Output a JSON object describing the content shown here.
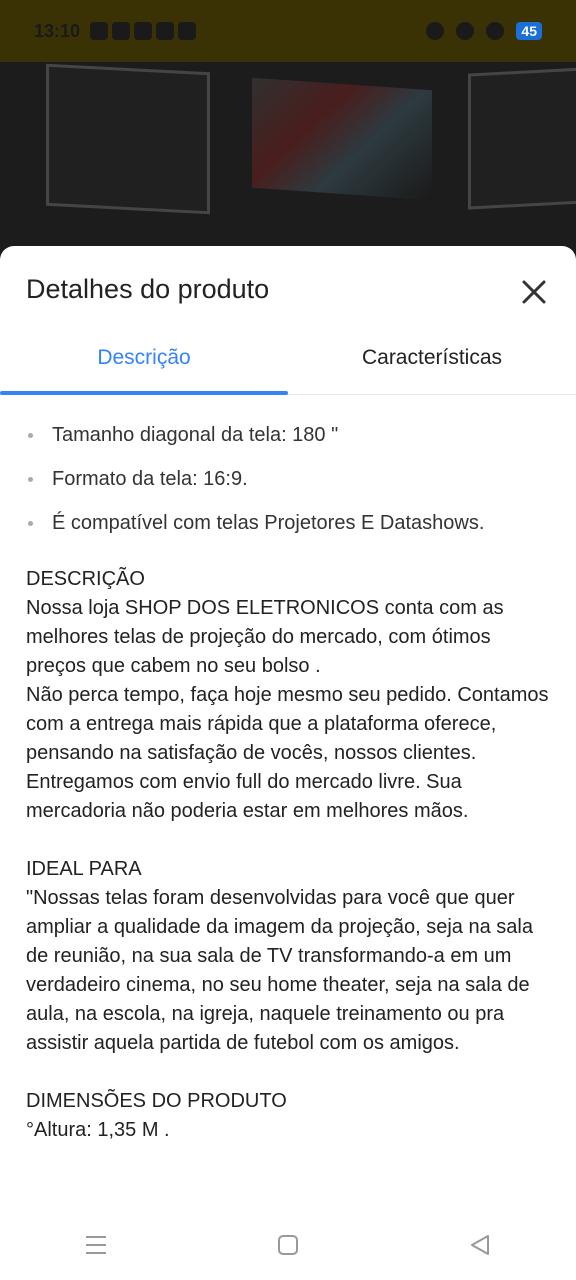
{
  "status_bar": {
    "time": "13:10",
    "battery": "45"
  },
  "sheet": {
    "title": "Detalhes do produto",
    "tabs": [
      {
        "label": "Descrição",
        "active": true
      },
      {
        "label": "Características",
        "active": false
      }
    ],
    "bullets": [
      "Tamanho diagonal da tela: 180 \"",
      "Formato da tela: 16:9.",
      "É compatível com telas Projetores E Datashows."
    ],
    "description": "DESCRIÇÃO\nNossa loja SHOP DOS ELETRONICOS conta com as melhores telas de projeção do mercado, com ótimos preços que cabem no seu bolso .\nNão perca tempo, faça hoje mesmo seu pedido. Contamos com a entrega mais rápida que a plataforma oferece, pensando na satisfação de vocês, nossos clientes. Entregamos com envio full do mercado livre. Sua mercadoria não poderia estar em melhores mãos.\n\nIDEAL PARA\n\"Nossas telas foram desenvolvidas para você que quer ampliar a qualidade da imagem da projeção, seja na sala de reunião, na sua sala de TV transformando-a em um verdadeiro cinema, no seu home theater, seja na sala de aula, na escola, na igreja, naquele treinamento ou pra assistir aquela partida de futebol com os amigos.\n\nDIMENSÕES DO PRODUTO\n°Altura: 1,35 M ."
  },
  "colors": {
    "accent": "#3483fa",
    "status_bar_bg": "#3a3205",
    "battery": "#1a6fd8"
  },
  "icons": [
    "close-icon",
    "menu-nav-icon",
    "home-nav-icon",
    "back-nav-icon"
  ]
}
